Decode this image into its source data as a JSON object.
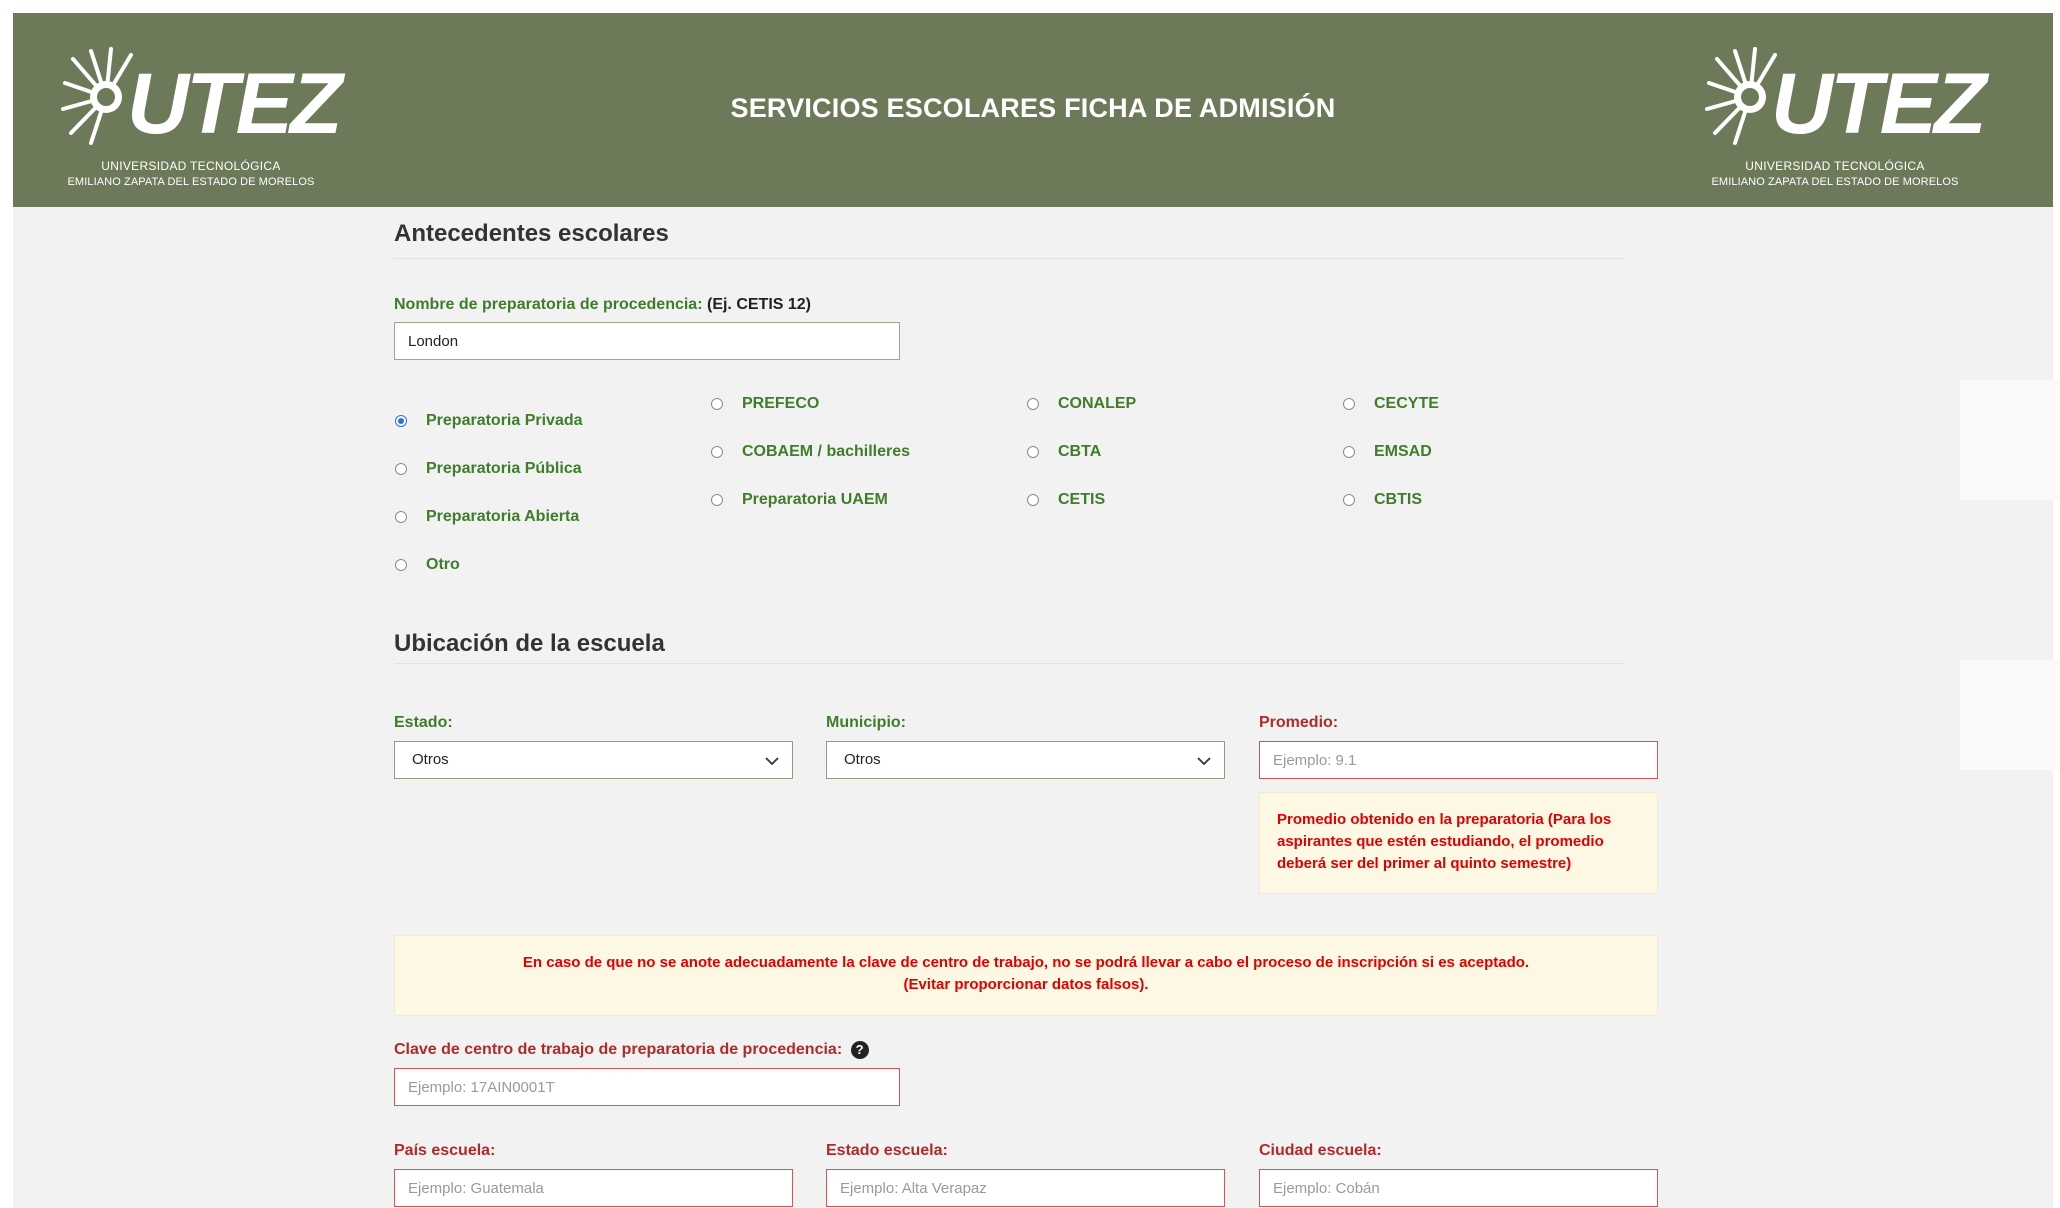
{
  "header": {
    "title": "SERVICIOS ESCOLARES FICHA DE ADMISIÓN",
    "logo_word": "UTEZ",
    "logo_line1": "UNIVERSIDAD TECNOLÓGICA",
    "logo_line2": "EMILIANO ZAPATA DEL ESTADO DE MORELOS"
  },
  "antecedentes": {
    "title": "Antecedentes escolares",
    "school_name_label": "Nombre de preparatoria de procedencia:",
    "school_name_example": "(Ej. CETIS 12)",
    "school_name_value": "London",
    "radio_col1": [
      "Preparatoria Privada",
      "Preparatoria Pública",
      "Preparatoria Abierta",
      "Otro"
    ],
    "radio_col2": [
      "PREFECO",
      "COBAEM / bachilleres",
      "Preparatoria UAEM"
    ],
    "radio_col3": [
      "CONALEP",
      "CBTA",
      "CETIS"
    ],
    "radio_col4": [
      "CECYTE",
      "EMSAD",
      "CBTIS"
    ],
    "selected": "Preparatoria Privada"
  },
  "ubicacion": {
    "title": "Ubicación de la escuela",
    "estado_label": "Estado:",
    "estado_value": "Otros",
    "municipio_label": "Municipio:",
    "municipio_value": "Otros",
    "promedio_label": "Promedio:",
    "promedio_placeholder": "Ejemplo: 9.1",
    "promedio_note": "Promedio obtenido en la preparatoria (Para los aspirantes que estén estudiando, el promedio deberá ser del primer al quinto semestre)"
  },
  "warning": {
    "line1": "En caso de que no se anote adecuadamente la clave de centro de trabajo, no se podrá llevar a cabo el proceso de inscripción si es aceptado.",
    "line2": "(Evitar proporcionar datos falsos)."
  },
  "clave": {
    "label": "Clave de centro de trabajo de preparatoria de procedencia:",
    "placeholder": "Ejemplo: 17AIN0001T",
    "help_icon": "?"
  },
  "escuela": {
    "pais_label": "País escuela:",
    "pais_placeholder": "Ejemplo: Guatemala",
    "estado_label": "Estado escuela:",
    "estado_placeholder": "Ejemplo: Alta Verapaz",
    "ciudad_label": "Ciudad escuela:",
    "ciudad_placeholder": "Ejemplo: Cobán"
  },
  "colors": {
    "header_bg": "#6d7a59",
    "label_green": "#3f7d2b",
    "label_red": "#b02a2a",
    "warning_text": "#e00000",
    "note_bg": "#fdf8e4"
  }
}
